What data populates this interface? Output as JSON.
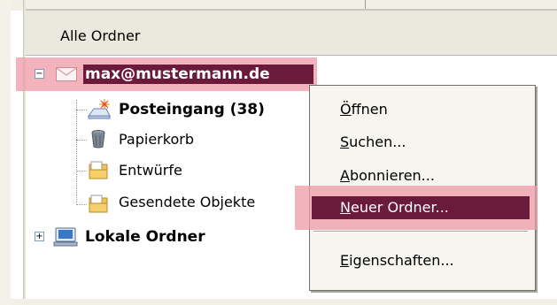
{
  "tree": {
    "header_label": "Alle Ordner",
    "account": {
      "label": "max@mustermann.de",
      "icon": "envelope-icon",
      "expanded": true
    },
    "folders": [
      {
        "label": "Posteingang (38)",
        "icon": "inbox-icon",
        "bold": true
      },
      {
        "label": "Papierkorb",
        "icon": "trash-icon",
        "bold": false
      },
      {
        "label": "Entwürfe",
        "icon": "folder-icon",
        "bold": false
      },
      {
        "label": "Gesendete Objekte",
        "icon": "folder-icon",
        "bold": false
      }
    ],
    "local": {
      "label": "Lokale Ordner",
      "icon": "computer-icon",
      "expanded": false
    }
  },
  "context_menu": {
    "items": [
      {
        "key": "Ö",
        "rest": "ffnen"
      },
      {
        "key": "S",
        "rest": "uchen..."
      },
      {
        "key": "A",
        "rest": "bonnieren..."
      },
      {
        "key": "N",
        "rest": "euer Ordner...",
        "selected": true
      },
      {
        "key": "E",
        "rest": "igenschaften..."
      }
    ]
  },
  "colors": {
    "selection": "#6a1a3b",
    "highlight": "#ef9aa6",
    "header_bg": "#ebe8dd"
  }
}
